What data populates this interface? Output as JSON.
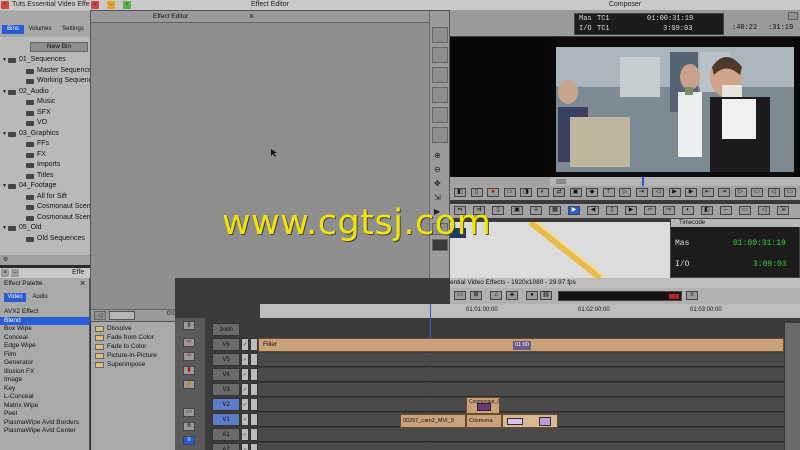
{
  "bins_window": {
    "title": "Tuts Essential Video Effects",
    "tabs": [
      "Bins",
      "Volumes",
      "Settings"
    ],
    "new_bin_label": "New Bin",
    "tree": [
      {
        "label": "01_Sequences",
        "level": 0
      },
      {
        "label": "Master Sequence",
        "level": 1
      },
      {
        "label": "Working Sequence",
        "level": 1
      },
      {
        "label": "02_Audio",
        "level": 0
      },
      {
        "label": "Music",
        "level": 1
      },
      {
        "label": "SFX",
        "level": 1
      },
      {
        "label": "VO",
        "level": 1
      },
      {
        "label": "03_Graphics",
        "level": 0
      },
      {
        "label": "FFs",
        "level": 1
      },
      {
        "label": "FX",
        "level": 1
      },
      {
        "label": "Imports",
        "level": 1
      },
      {
        "label": "Titles",
        "level": 1
      },
      {
        "label": "04_Footage",
        "level": 0
      },
      {
        "label": "All for Sift",
        "level": 1
      },
      {
        "label": "Cosmonaut Scene",
        "level": 1
      },
      {
        "label": "Cosmonaut Scene",
        "level": 1
      },
      {
        "label": "05_Old",
        "level": 0
      },
      {
        "label": "Old Sequences",
        "level": 1
      }
    ]
  },
  "system_titlebar": "Effect Editor",
  "effect_editor": {
    "title": "Effect Editor",
    "position_time": "0:00"
  },
  "effect_palette": {
    "title": "Effect Palette",
    "header_right": "Effe",
    "tabs": [
      "Video",
      "Audio"
    ],
    "categories": [
      "AVX2 Effect",
      "Blend",
      "Box Wipe",
      "Conceal",
      "Edge Wipe",
      "Film",
      "Generator",
      "Illusion FX",
      "Image",
      "Key",
      "L-Conceal",
      "Matrix Wipe",
      "Peel",
      "PlasmaWipe Avid Borders",
      "PlasmaWipe Avid Center"
    ],
    "selected_category": "Blend",
    "effects": [
      "Dissolve",
      "Fade from Color",
      "Fade to Color",
      "Picture-in-Picture",
      "Superimpose"
    ]
  },
  "composer": {
    "title": "Composer",
    "tc1_label": "Mas",
    "tc1_name": "TC1",
    "tc1_value": "01:00:31:19",
    "tc2_label": "I/O",
    "tc2_name": "TC1",
    "tc2_value": "3:09:03",
    "dur_left": ":40:22",
    "dur_right": ":31:19"
  },
  "timecode_window": {
    "title": "Timecode",
    "row1_label": "Mas",
    "row1_value": "01:00:31:19",
    "row2_label": "I/O",
    "row2_value": "3:09:03"
  },
  "timeline": {
    "title": "ential Video Effects - 1920x1080 - 29.97 fps",
    "ruler_labels": [
      "01:01:00:00",
      "01:02:00:00",
      "01:03:00:00"
    ],
    "record_track": "Josh",
    "tracks": [
      "V6",
      "V5",
      "V4",
      "V3",
      "V2",
      "V1",
      "A1",
      "A2"
    ],
    "filler_label": "Filler",
    "filler_marker": "01:00",
    "clip_v1_a": "00297_cam2_MVI_9",
    "clip_v1_b": "Cosmona",
    "clip_v2": "Cosmonaut_Gt"
  },
  "watermark": "www.cgtsj.com",
  "colors": {
    "accent_blue": "#2a5bd7",
    "timeline_clip": "#c9a27c",
    "tc_green": "#37d13a",
    "watermark": "#f2e600"
  }
}
